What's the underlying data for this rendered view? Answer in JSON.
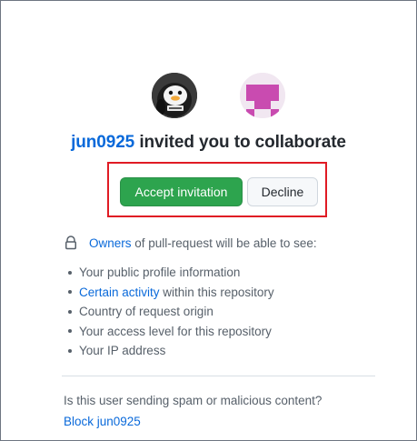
{
  "invite": {
    "inviter": "jun0925",
    "invite_text": "invited you to collaborate",
    "inviter_avatar": "penguin-avatar",
    "repo_avatar": "identicon-avatar"
  },
  "actions": {
    "accept_label": "Accept invitation",
    "decline_label": "Decline"
  },
  "permissions": {
    "lock_icon": "lock-icon",
    "owners_link": "Owners",
    "intro_text": "of pull-request will be able to see:",
    "items": [
      {
        "link": "",
        "text": "Your public profile information"
      },
      {
        "link": "Certain activity",
        "text": "within this repository"
      },
      {
        "link": "",
        "text": "Country of request origin"
      },
      {
        "link": "",
        "text": "Your access level for this repository"
      },
      {
        "link": "",
        "text": "Your IP address"
      }
    ]
  },
  "spam": {
    "question": "Is this user sending spam or malicious content?",
    "block_label": "Block jun0925"
  },
  "colors": {
    "accept_green": "#2da44e",
    "link_blue": "#0969da",
    "highlight_red": "#e01b24",
    "identicon_magenta": "#c94bb0"
  }
}
